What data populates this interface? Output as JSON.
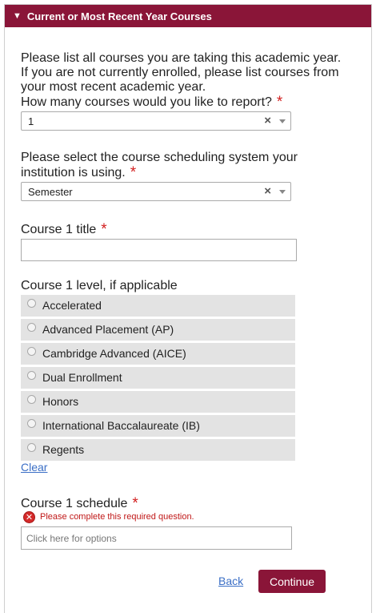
{
  "section": {
    "toggle_icon": "triangle-down-icon",
    "title": "Current or Most Recent Year Courses"
  },
  "intro": {
    "line1": "Please list all courses you are taking this academic year.",
    "line2": "If you are not currently enrolled, please list courses from",
    "line3": "your most recent academic year."
  },
  "required_marker": "*",
  "q_count": {
    "label": "How many courses would you like to report?",
    "value": "1"
  },
  "q_scheduling": {
    "label_line1": "Please select the course scheduling system your",
    "label_line2": "institution is using.",
    "value": "Semester"
  },
  "q_title": {
    "label": "Course 1 title",
    "value": ""
  },
  "q_level": {
    "label": "Course 1 level, if applicable",
    "options": [
      "Accelerated",
      "Advanced Placement (AP)",
      "Cambridge Advanced (AICE)",
      "Dual Enrollment",
      "Honors",
      "International Baccalaureate (IB)",
      "Regents"
    ],
    "clear_label": "Clear"
  },
  "q_schedule": {
    "label": "Course 1 schedule",
    "error": "Please complete this required question.",
    "placeholder": "Click here for options"
  },
  "nav": {
    "back_label": "Back",
    "continue_label": "Continue"
  },
  "colors": {
    "brand": "#8a1538",
    "required": "#d21f1f",
    "error": "#c01818",
    "link": "#3b6fc6"
  }
}
